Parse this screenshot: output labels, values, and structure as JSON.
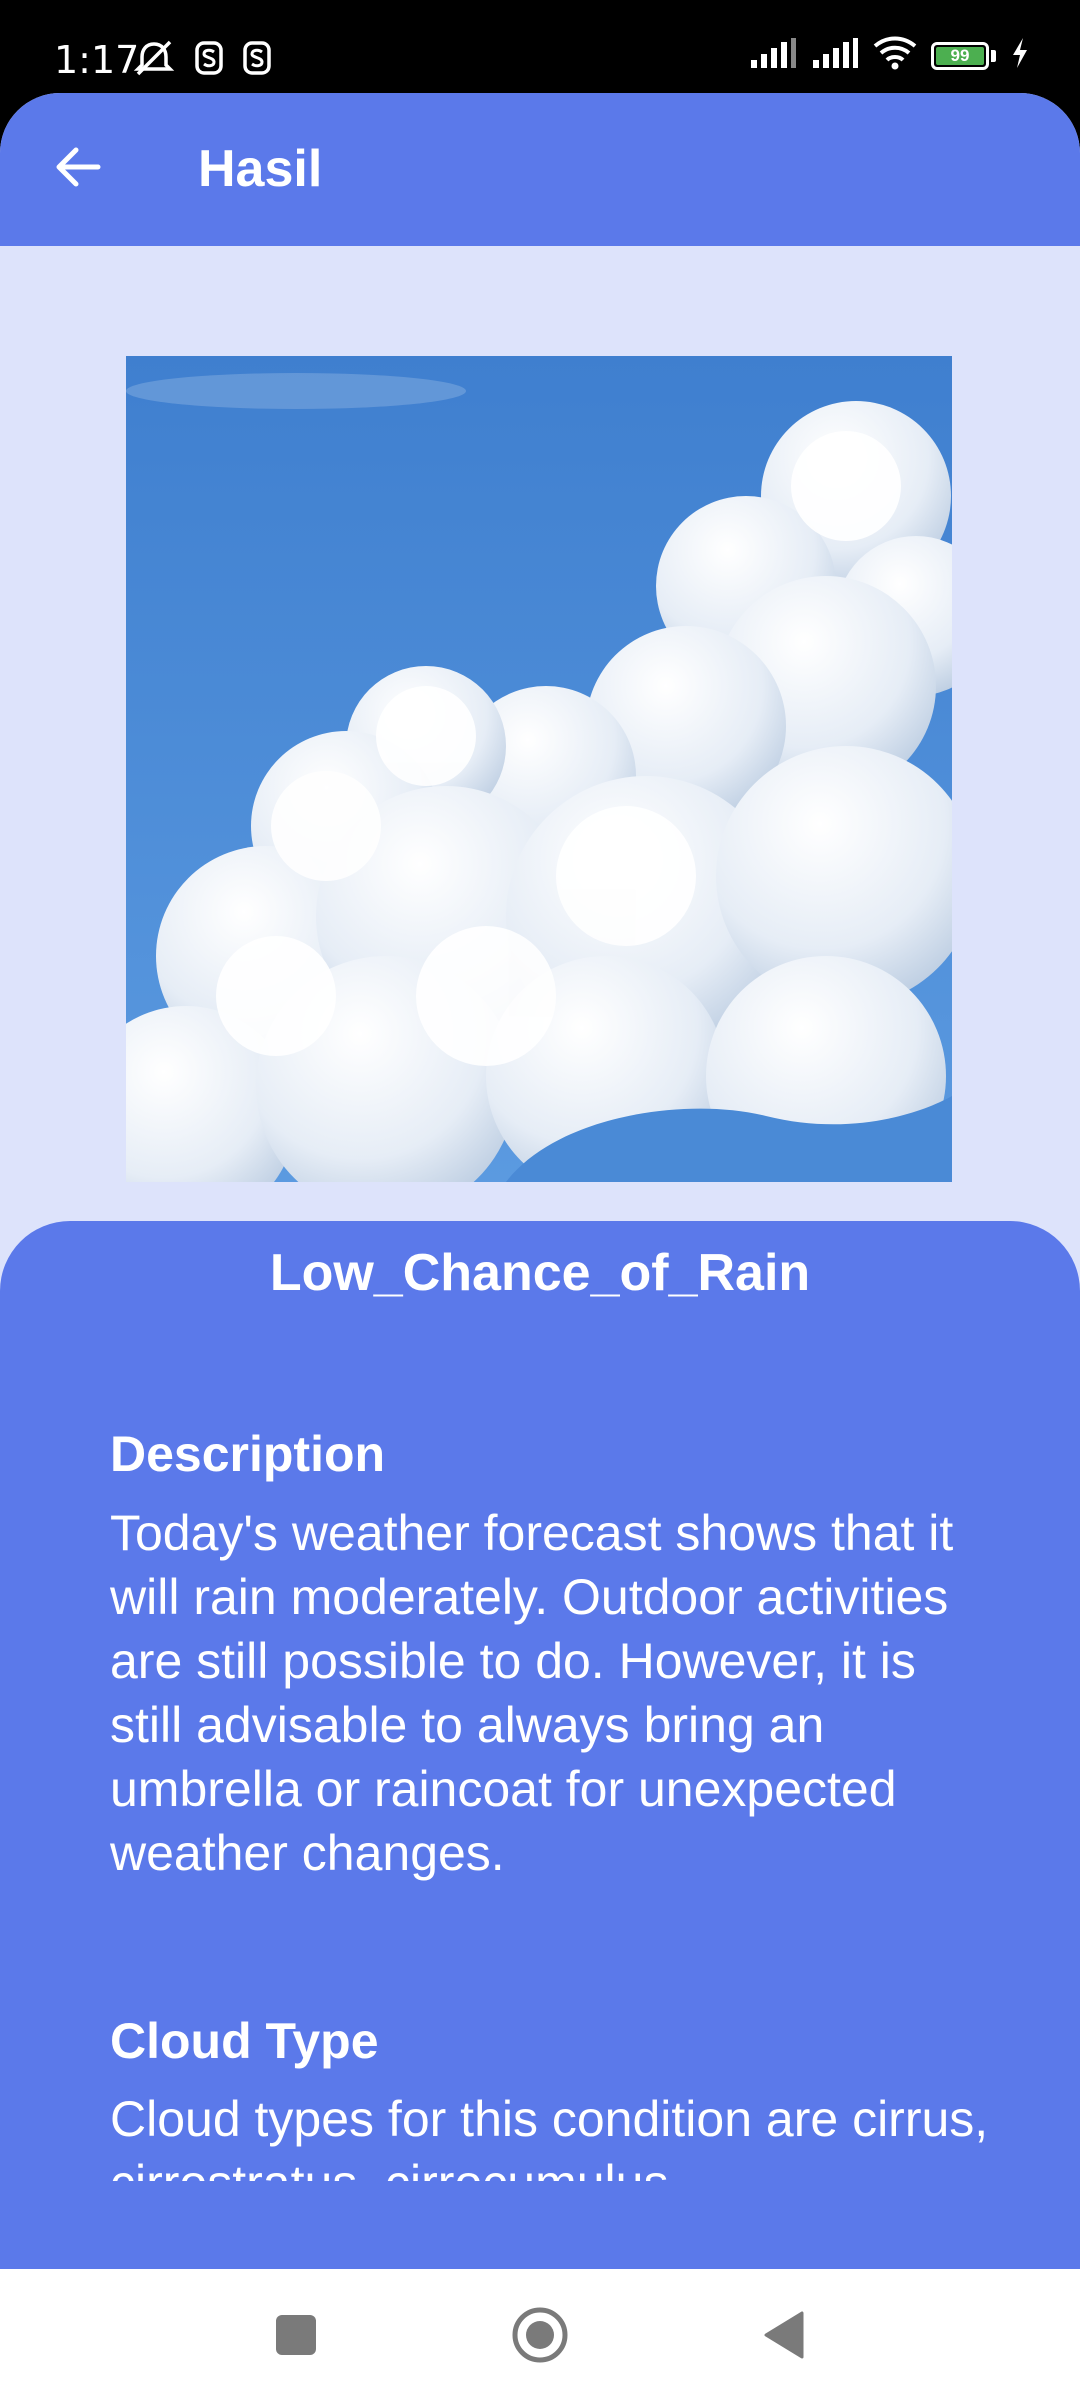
{
  "status_bar": {
    "time": "1:17",
    "battery_level": "99",
    "icons_left": [
      "alarm-off-icon",
      "app-notification-icon",
      "app-notification-icon"
    ],
    "icons_right": [
      "signal-icon",
      "signal-icon",
      "wifi-icon",
      "battery-icon",
      "charging-icon"
    ]
  },
  "app_bar": {
    "title": "Hasil",
    "back_icon": "arrow-left-icon"
  },
  "result": {
    "image_subject": "cumulus clouds in blue sky",
    "condition_label": "Low_Chance_of_Rain",
    "description_heading": "Description",
    "description_text": "Today's weather forecast shows that it will rain moderately. Outdoor activities are still possible to do. However, it is still advisable to always bring an umbrella or raincoat for unexpected weather changes.",
    "cloud_type_heading": "Cloud Type",
    "cloud_type_text": "Cloud types for this condition are cirrus, cirrostratus, cirrocumulus"
  },
  "nav_bar": {
    "buttons": [
      "recents-square-icon",
      "home-circle-icon",
      "back-triangle-icon"
    ]
  },
  "colors": {
    "primary": "#5b79ea",
    "background": "#dde3fb",
    "sky": "#3b7fd1"
  }
}
